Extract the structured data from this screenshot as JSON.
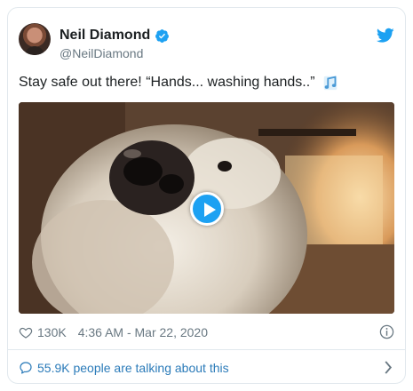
{
  "author": {
    "name": "Neil Diamond",
    "handle": "@NeilDiamond"
  },
  "tweet": {
    "text": "Stay safe out there! “Hands... washing hands..”",
    "emoji": "musical-notes-icon"
  },
  "media": {
    "type": "video",
    "play_icon": "play-icon"
  },
  "meta": {
    "likes": "130K",
    "timestamp": "4:36 AM - Mar 22, 2020"
  },
  "footer": {
    "talking": "55.9K people are talking about this"
  },
  "colors": {
    "accent": "#1da1f2",
    "link": "#2b7bb9",
    "secondary_text": "#697882",
    "border": "#e1e8ed"
  }
}
